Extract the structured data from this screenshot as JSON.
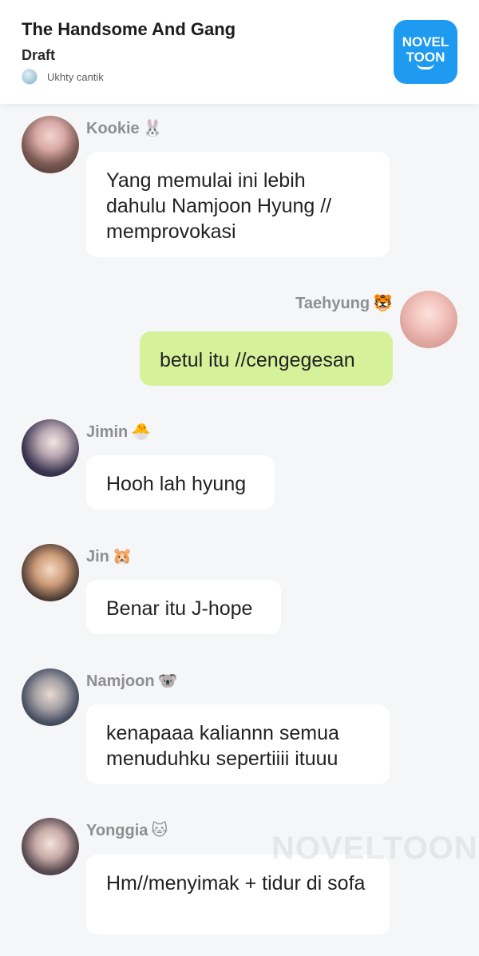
{
  "header": {
    "story_title": "The Handsome And Gang",
    "chapter_label": "Draft",
    "author_name": "Ukhty cantik",
    "brand": {
      "line1": "NOVEL",
      "line2": "TOON",
      "color": "#1e9bf0"
    }
  },
  "messages": [
    {
      "sender": "Kookie",
      "emoji": "🐰",
      "side": "left",
      "text": "Yang memulai ini lebih dahulu Namjoon Hyung // memprovokasi"
    },
    {
      "sender": "Taehyung",
      "emoji": "🐯",
      "side": "right",
      "text": "betul itu //cengegesan"
    },
    {
      "sender": "Jimin",
      "emoji": "🐣",
      "side": "left",
      "text": "Hooh lah hyung"
    },
    {
      "sender": "Jin",
      "emoji": "🐹",
      "side": "left",
      "text": "Benar itu J-hope"
    },
    {
      "sender": "Namjoon",
      "emoji": "🐨",
      "side": "left",
      "text": "kenapaaa kaliannn semua menuduhku sepertiiii ituuu"
    },
    {
      "sender": "Yonggia",
      "emoji": "🐱",
      "side": "left",
      "text": "Hm//menyimak + tidur di sofa"
    }
  ],
  "watermark": "NOVELTOON",
  "colors": {
    "background": "#f5f6f8",
    "bubble_other": "#ffffff",
    "bubble_self": "#d5f19a",
    "sender_name": "#8e8e8e"
  }
}
